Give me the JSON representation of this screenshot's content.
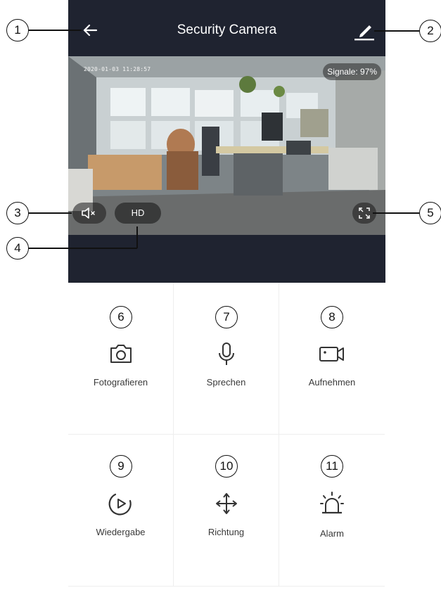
{
  "header": {
    "title": "Security Camera",
    "back_icon": "back-arrow-icon",
    "edit_icon": "pencil-icon"
  },
  "video": {
    "timestamp": "2020-01-03 11:28:57",
    "signal": "Signale: 97%",
    "quality_label": "HD",
    "mute_icon": "speaker-muted-icon",
    "fullscreen_icon": "fullscreen-icon"
  },
  "actions": [
    {
      "label": "Fotografieren",
      "icon": "camera-icon",
      "callout": "6"
    },
    {
      "label": "Sprechen",
      "icon": "microphone-icon",
      "callout": "7"
    },
    {
      "label": "Aufnehmen",
      "icon": "video-record-icon",
      "callout": "8"
    },
    {
      "label": "Wiedergabe",
      "icon": "playback-icon",
      "callout": "9"
    },
    {
      "label": "Richtung",
      "icon": "direction-move-icon",
      "callout": "10"
    },
    {
      "label": "Alarm",
      "icon": "alarm-siren-icon",
      "callout": "11"
    }
  ],
  "callouts": [
    "1",
    "2",
    "3",
    "4",
    "5"
  ],
  "colors": {
    "header_bg": "#1f2330",
    "text_dark": "#3a3a3a",
    "icon_color": "#333333"
  }
}
